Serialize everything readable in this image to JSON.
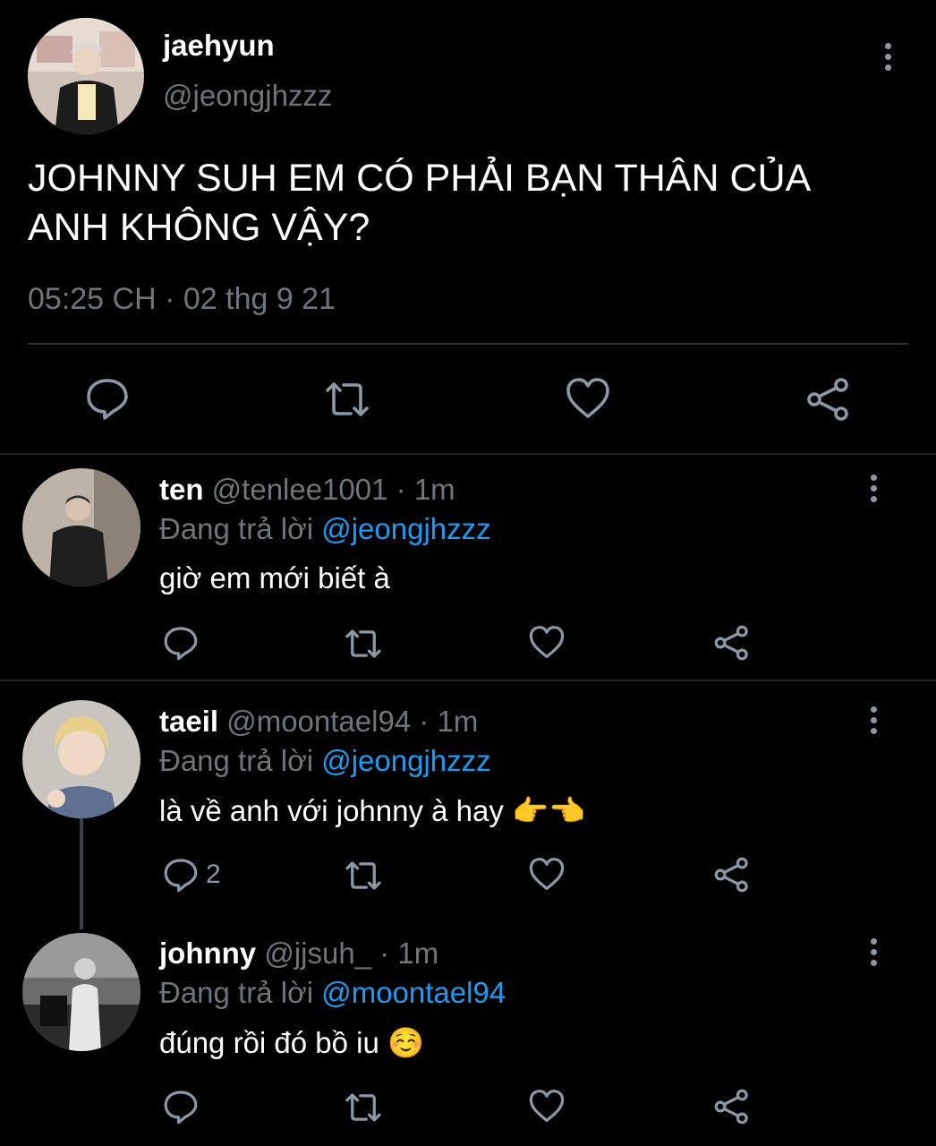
{
  "main_tweet": {
    "display_name": "jaehyun",
    "handle": "@jeongjhzzz",
    "text_line1": "JOHNNY SUH EM CÓ PHẢI BẠN THÂN CỦA",
    "text_line2": "ANH KHÔNG VẬY?",
    "timestamp": "05:25 CH · 02 thg 9 21"
  },
  "replies": [
    {
      "display_name": "ten",
      "handle": "@tenlee1001",
      "time": "· 1m",
      "replying_prefix": "Đang trả lời",
      "replying_to": "@jeongjhzzz",
      "text": "giờ em mới biết à",
      "emoji": "",
      "reply_count": ""
    },
    {
      "display_name": "taeil",
      "handle": "@moontael94",
      "time": "· 1m",
      "replying_prefix": "Đang trả lời",
      "replying_to": "@jeongjhzzz",
      "text": "là về anh với johnny à hay",
      "emoji": "👉👈",
      "reply_count": "2"
    },
    {
      "display_name": "johnny",
      "handle": "@jjsuh_",
      "time": "· 1m",
      "replying_prefix": "Đang trả lời",
      "replying_to": "@moontael94",
      "text": "đúng rồi đó bồ iu",
      "emoji": "☺️",
      "reply_count": ""
    }
  ],
  "icons": {
    "reply": "speech-bubble",
    "retweet": "retweet-arrows",
    "like": "heart",
    "share": "share-nodes",
    "more": "vertical-dots"
  },
  "colors": {
    "background": "#000000",
    "text": "#e7e9ea",
    "muted": "#6e767d",
    "link": "#1d9bf0",
    "icon": "#8b98a5"
  }
}
